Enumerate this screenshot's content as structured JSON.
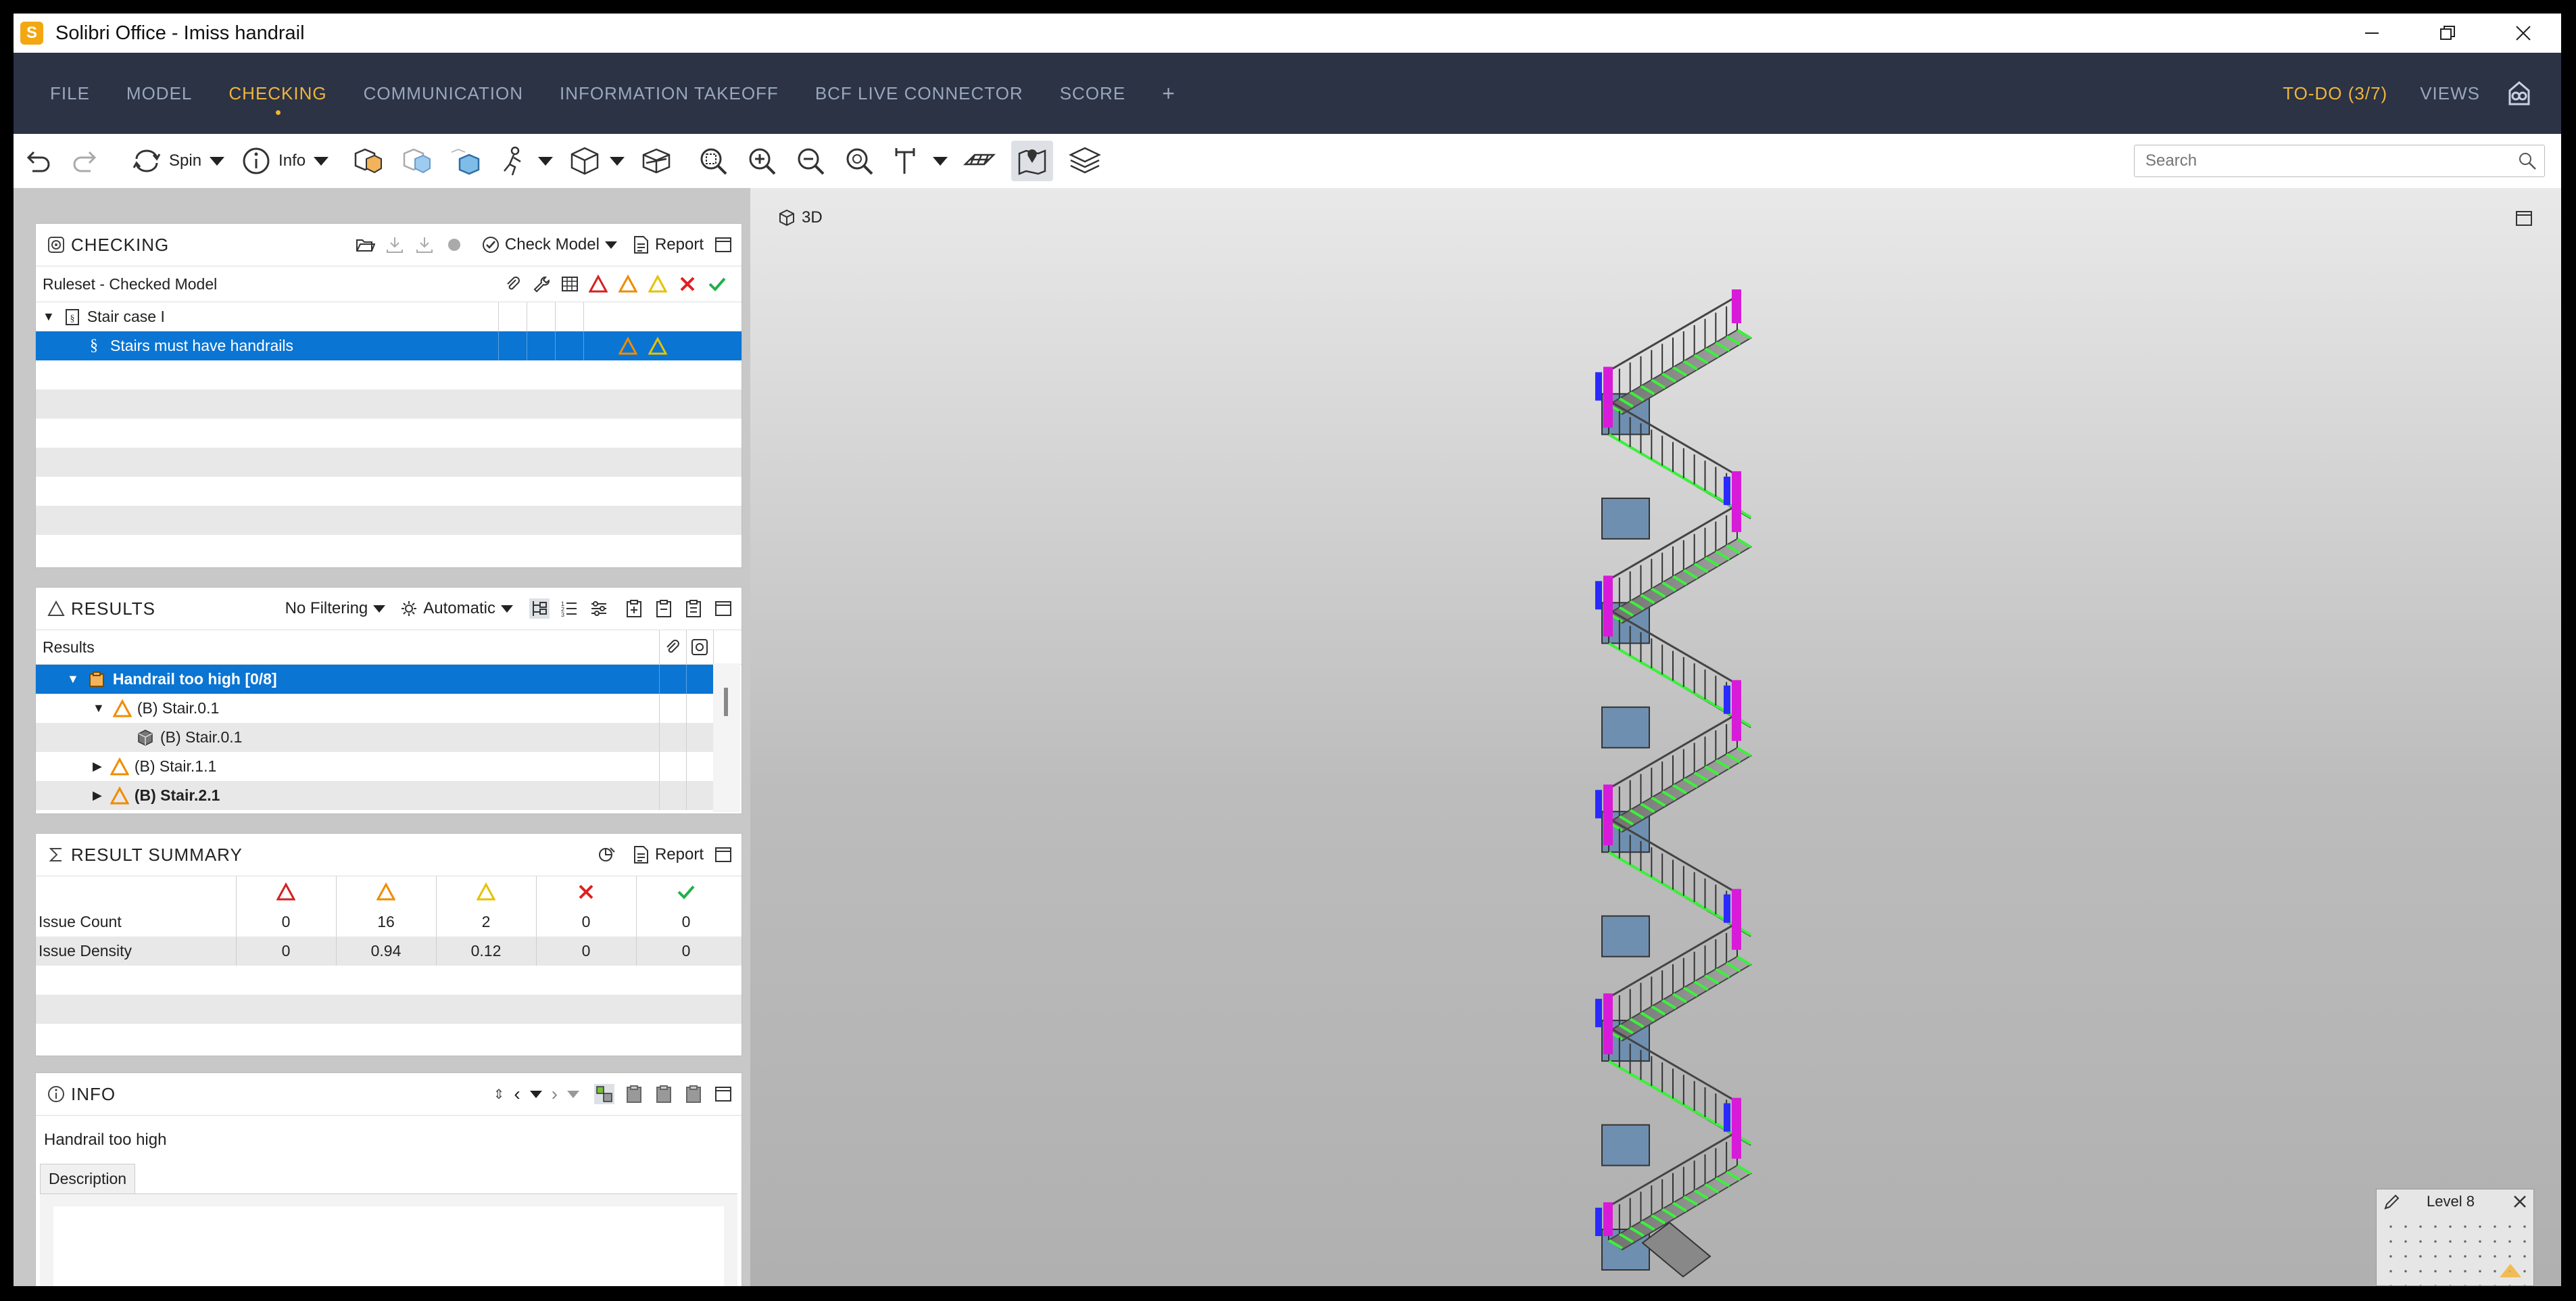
{
  "window": {
    "app_icon_letter": "S",
    "title": "Solibri Office - Imiss handrail"
  },
  "menu": {
    "items": [
      "FILE",
      "MODEL",
      "CHECKING",
      "COMMUNICATION",
      "INFORMATION TAKEOFF",
      "BCF LIVE CONNECTOR",
      "SCORE",
      "+"
    ],
    "active": "CHECKING",
    "todo": "TO-DO (3/7)",
    "views": "VIEWS"
  },
  "toolbar": {
    "spin_label": "Spin",
    "info_label": "Info",
    "search_placeholder": "Search"
  },
  "checking": {
    "title": "CHECKING",
    "check_model_label": "Check Model",
    "report_label": "Report",
    "header_label": "Ruleset - Checked Model",
    "ruleset_name": "Stair case I",
    "rule_name": "Stairs must have handrails"
  },
  "results": {
    "title": "RESULTS",
    "filter_label": "No Filtering",
    "mode_label": "Automatic",
    "column_label": "Results",
    "rows": [
      {
        "label": "Handrail too high [0/8]",
        "level": 1,
        "selected": true
      },
      {
        "label": "(B) Stair.0.1",
        "level": 2
      },
      {
        "label": "(B) Stair.0.1",
        "level": 3
      },
      {
        "label": "(B) Stair.1.1",
        "level": 2
      },
      {
        "label": "(B) Stair.2.1",
        "level": 2
      }
    ]
  },
  "summary": {
    "title": "RESULT SUMMARY",
    "report_label": "Report",
    "rows": [
      {
        "label": "Issue Count",
        "values": [
          "0",
          "16",
          "2",
          "0",
          "0"
        ]
      },
      {
        "label": "Issue Density",
        "values": [
          "0",
          "0.94",
          "0.12",
          "0",
          "0"
        ]
      }
    ]
  },
  "info": {
    "title": "INFO",
    "item_name": "Handrail too high",
    "tab_label": "Description"
  },
  "viewport": {
    "label": "3D",
    "level_label": "Level 8"
  },
  "colors": {
    "menu_bg": "#2b3345",
    "accent": "#f0b43c",
    "selection": "#0a75d3",
    "critical": "#d62020",
    "moderate": "#f08c00",
    "low": "#e6c200",
    "rejected": "#e02020",
    "passed": "#22b04b",
    "handrail_issue": "#d81bd8",
    "component_ok": "#3cf03c"
  }
}
